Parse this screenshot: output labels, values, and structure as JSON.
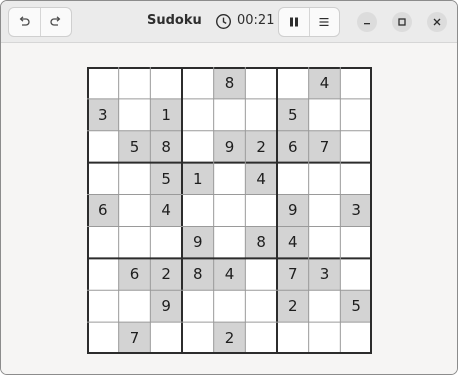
{
  "app": {
    "title": "Sudoku",
    "timer": "00:21"
  },
  "icons": {
    "undo": "undo-icon",
    "redo": "redo-icon",
    "clock": "clock-icon",
    "pause": "pause-icon",
    "menu": "hamburger-menu-icon",
    "minimize": "minimize-icon",
    "maximize": "maximize-icon",
    "close": "close-icon"
  },
  "colors": {
    "given_cell_bg": "#d3d3d3",
    "empty_cell_bg": "#ffffff",
    "grid_thin": "#9a9a9a",
    "grid_thick": "#2c2c2c"
  },
  "board": {
    "rows": [
      [
        "",
        "",
        "",
        "",
        "8",
        "",
        "",
        "4",
        ""
      ],
      [
        "3",
        "",
        "1",
        "",
        "",
        "",
        "5",
        "",
        ""
      ],
      [
        "",
        "5",
        "8",
        "",
        "9",
        "2",
        "6",
        "7",
        ""
      ],
      [
        "",
        "",
        "5",
        "1",
        "",
        "4",
        "",
        "",
        ""
      ],
      [
        "6",
        "",
        "4",
        "",
        "",
        "",
        "9",
        "",
        "3"
      ],
      [
        "",
        "",
        "",
        "9",
        "",
        "8",
        "4",
        "",
        ""
      ],
      [
        "",
        "6",
        "2",
        "8",
        "4",
        "",
        "7",
        "3",
        ""
      ],
      [
        "",
        "",
        "9",
        "",
        "",
        "",
        "2",
        "",
        "5"
      ],
      [
        "",
        "7",
        "",
        "",
        "2",
        "",
        "",
        "",
        ""
      ]
    ]
  }
}
